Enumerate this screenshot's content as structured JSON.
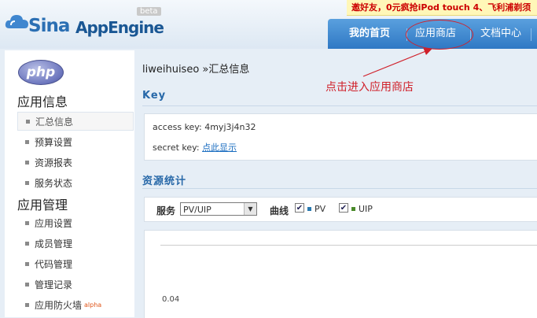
{
  "header": {
    "logo_sina": "Sina",
    "logo_app": "AppEngine",
    "beta": "beta",
    "promo": "邀好友，0元疯抢iPod touch 4、飞利浦剃须",
    "nav": [
      {
        "label": "我的首页",
        "active": true
      },
      {
        "label": "应用商店",
        "active": false
      },
      {
        "label": "文档中心",
        "active": false
      }
    ]
  },
  "sidebar": {
    "php_logo": "php",
    "section1": "应用信息",
    "items1": [
      "汇总信息",
      "预算设置",
      "资源报表",
      "服务状态"
    ],
    "section2": "应用管理",
    "items2": [
      "应用设置",
      "成员管理",
      "代码管理",
      "管理记录",
      "应用防火墙"
    ],
    "alpha": "alpha"
  },
  "main": {
    "breadcrumb": "liweihuiseo »汇总信息",
    "annotation": "点击进入应用商店",
    "key_heading": "Key",
    "access_key_label": "access key: 4myj3j4n32",
    "secret_key_label": "secret key: ",
    "secret_key_link": "点此显示",
    "stats_heading": "资源统计",
    "service_label": "服务",
    "service_value": "PV/UIP",
    "curve_label": "曲线",
    "series": [
      {
        "name": "PV",
        "checked": true,
        "color": "#2a7ab0"
      },
      {
        "name": "UIP",
        "checked": true,
        "color": "#4a8a2a"
      }
    ],
    "y_tick": "0.04"
  },
  "colors": {
    "accent": "#2f78c4",
    "annotation": "#d0202a",
    "heading": "#2768a8"
  }
}
